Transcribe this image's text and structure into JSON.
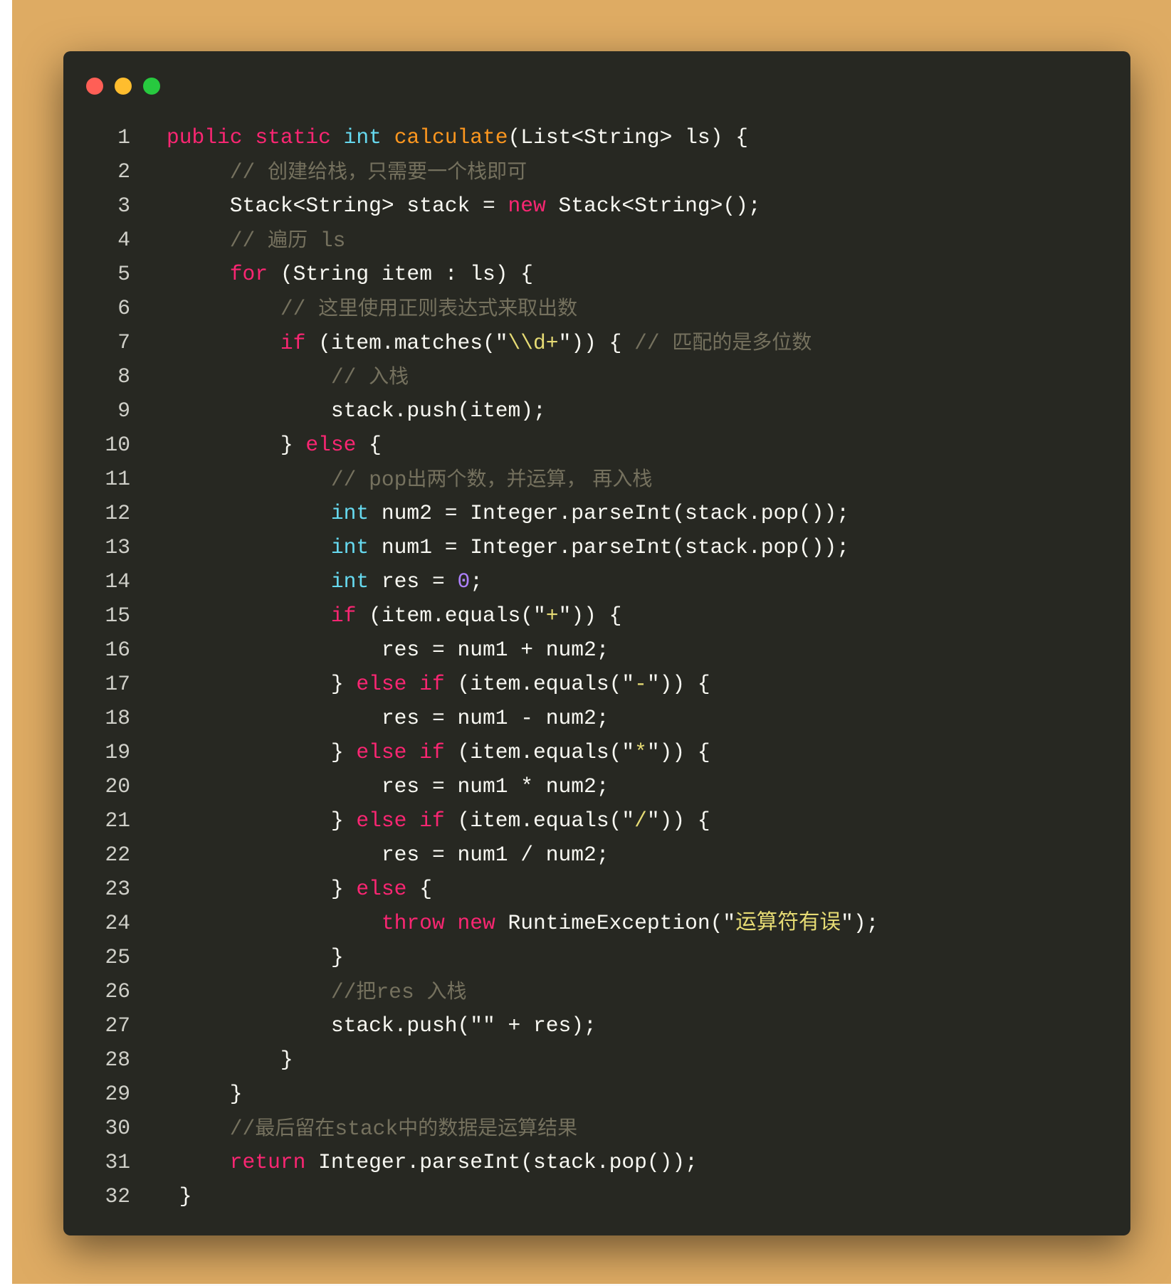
{
  "window": {
    "controls": [
      {
        "name": "close",
        "color": "#ff5f56"
      },
      {
        "name": "minimize",
        "color": "#ffbd2e"
      },
      {
        "name": "maximize",
        "color": "#27c93f"
      }
    ]
  },
  "theme": {
    "background": "#deab63",
    "editor_background": "#272822",
    "keyword": "#f92672",
    "type": "#66d9ef",
    "function": "#fd971f",
    "string": "#e6db74",
    "number": "#ae81ff",
    "comment": "#75715e",
    "plain": "#f8f8f2"
  },
  "code": {
    "language": "java",
    "lines": [
      {
        "n": "1",
        "tokens": [
          [
            "kw",
            "public"
          ],
          [
            "pl",
            " "
          ],
          [
            "kw",
            "static"
          ],
          [
            "pl",
            " "
          ],
          [
            "type",
            "int"
          ],
          [
            "pl",
            " "
          ],
          [
            "fn",
            "calculate"
          ],
          [
            "pl",
            "(List<String> ls) {"
          ]
        ]
      },
      {
        "n": "2",
        "tokens": [
          [
            "pl",
            "     "
          ],
          [
            "cmm",
            "// "
          ],
          [
            "cm",
            "创建给栈，只需要一个栈即可"
          ]
        ]
      },
      {
        "n": "3",
        "tokens": [
          [
            "pl",
            "     Stack<String> stack = "
          ],
          [
            "kw",
            "new"
          ],
          [
            "pl",
            " Stack<String>();"
          ]
        ]
      },
      {
        "n": "4",
        "tokens": [
          [
            "pl",
            "     "
          ],
          [
            "cmm",
            "// "
          ],
          [
            "cm",
            "遍历"
          ],
          [
            "cmm",
            " ls"
          ]
        ]
      },
      {
        "n": "5",
        "tokens": [
          [
            "pl",
            "     "
          ],
          [
            "kw",
            "for"
          ],
          [
            "pl",
            " (String item : ls) {"
          ]
        ]
      },
      {
        "n": "6",
        "tokens": [
          [
            "pl",
            "         "
          ],
          [
            "cmm",
            "// "
          ],
          [
            "cm",
            "这里使用正则表达式来取出数"
          ]
        ]
      },
      {
        "n": "7",
        "tokens": [
          [
            "pl",
            "         "
          ],
          [
            "kw",
            "if"
          ],
          [
            "pl",
            " (item.matches(\""
          ],
          [
            "str",
            "\\\\d+"
          ],
          [
            "pl",
            "\")) { "
          ],
          [
            "cmm",
            "// "
          ],
          [
            "cm",
            "匹配的是多位数"
          ]
        ]
      },
      {
        "n": "8",
        "tokens": [
          [
            "pl",
            "             "
          ],
          [
            "cmm",
            "// "
          ],
          [
            "cm",
            "入栈"
          ]
        ]
      },
      {
        "n": "9",
        "tokens": [
          [
            "pl",
            "             stack.push(item);"
          ]
        ]
      },
      {
        "n": "10",
        "tokens": [
          [
            "pl",
            "         } "
          ],
          [
            "kw",
            "else"
          ],
          [
            "pl",
            " {"
          ]
        ]
      },
      {
        "n": "11",
        "tokens": [
          [
            "pl",
            "             "
          ],
          [
            "cmm",
            "// pop"
          ],
          [
            "cm",
            "出两个数，并运算， 再入栈"
          ]
        ]
      },
      {
        "n": "12",
        "tokens": [
          [
            "pl",
            "             "
          ],
          [
            "type",
            "int"
          ],
          [
            "pl",
            " num2 = Integer.parseInt(stack.pop());"
          ]
        ]
      },
      {
        "n": "13",
        "tokens": [
          [
            "pl",
            "             "
          ],
          [
            "type",
            "int"
          ],
          [
            "pl",
            " num1 = Integer.parseInt(stack.pop());"
          ]
        ]
      },
      {
        "n": "14",
        "tokens": [
          [
            "pl",
            "             "
          ],
          [
            "type",
            "int"
          ],
          [
            "pl",
            " res = "
          ],
          [
            "num",
            "0"
          ],
          [
            "pl",
            ";"
          ]
        ]
      },
      {
        "n": "15",
        "tokens": [
          [
            "pl",
            "             "
          ],
          [
            "kw",
            "if"
          ],
          [
            "pl",
            " (item.equals(\""
          ],
          [
            "str",
            "+"
          ],
          [
            "pl",
            "\")) {"
          ]
        ]
      },
      {
        "n": "16",
        "tokens": [
          [
            "pl",
            "                 res = num1 + num2;"
          ]
        ]
      },
      {
        "n": "17",
        "tokens": [
          [
            "pl",
            "             } "
          ],
          [
            "kw",
            "else"
          ],
          [
            "pl",
            " "
          ],
          [
            "kw",
            "if"
          ],
          [
            "pl",
            " (item.equals(\""
          ],
          [
            "str",
            "-"
          ],
          [
            "pl",
            "\")) {"
          ]
        ]
      },
      {
        "n": "18",
        "tokens": [
          [
            "pl",
            "                 res = num1 - num2;"
          ]
        ]
      },
      {
        "n": "19",
        "tokens": [
          [
            "pl",
            "             } "
          ],
          [
            "kw",
            "else"
          ],
          [
            "pl",
            " "
          ],
          [
            "kw",
            "if"
          ],
          [
            "pl",
            " (item.equals(\""
          ],
          [
            "str",
            "*"
          ],
          [
            "pl",
            "\")) {"
          ]
        ]
      },
      {
        "n": "20",
        "tokens": [
          [
            "pl",
            "                 res = num1 * num2;"
          ]
        ]
      },
      {
        "n": "21",
        "tokens": [
          [
            "pl",
            "             } "
          ],
          [
            "kw",
            "else"
          ],
          [
            "pl",
            " "
          ],
          [
            "kw",
            "if"
          ],
          [
            "pl",
            " (item.equals(\""
          ],
          [
            "str",
            "/"
          ],
          [
            "pl",
            "\")) {"
          ]
        ]
      },
      {
        "n": "22",
        "tokens": [
          [
            "pl",
            "                 res = num1 / num2;"
          ]
        ]
      },
      {
        "n": "23",
        "tokens": [
          [
            "pl",
            "             } "
          ],
          [
            "kw",
            "else"
          ],
          [
            "pl",
            " {"
          ]
        ]
      },
      {
        "n": "24",
        "tokens": [
          [
            "pl",
            "                 "
          ],
          [
            "kw",
            "throw"
          ],
          [
            "pl",
            " "
          ],
          [
            "kw",
            "new"
          ],
          [
            "pl",
            " RuntimeException(\""
          ],
          [
            "str",
            "运算符有误"
          ],
          [
            "pl",
            "\");"
          ]
        ]
      },
      {
        "n": "25",
        "tokens": [
          [
            "pl",
            "             }"
          ]
        ]
      },
      {
        "n": "26",
        "tokens": [
          [
            "pl",
            "             "
          ],
          [
            "cmm",
            "//"
          ],
          [
            "cm",
            "把"
          ],
          [
            "cmm",
            "res "
          ],
          [
            "cm",
            "入栈"
          ]
        ]
      },
      {
        "n": "27",
        "tokens": [
          [
            "pl",
            "             stack.push(\"\" + res);"
          ]
        ]
      },
      {
        "n": "28",
        "tokens": [
          [
            "pl",
            "         }"
          ]
        ]
      },
      {
        "n": "29",
        "tokens": [
          [
            "pl",
            "     }"
          ]
        ]
      },
      {
        "n": "30",
        "tokens": [
          [
            "pl",
            "     "
          ],
          [
            "cmm",
            "//"
          ],
          [
            "cm",
            "最后留在"
          ],
          [
            "cmm",
            "stack"
          ],
          [
            "cm",
            "中的数据是运算结果"
          ]
        ]
      },
      {
        "n": "31",
        "tokens": [
          [
            "pl",
            "     "
          ],
          [
            "kw",
            "return"
          ],
          [
            "pl",
            " Integer.parseInt(stack.pop());"
          ]
        ]
      },
      {
        "n": "32",
        "tokens": [
          [
            "pl",
            " }"
          ]
        ]
      }
    ]
  }
}
